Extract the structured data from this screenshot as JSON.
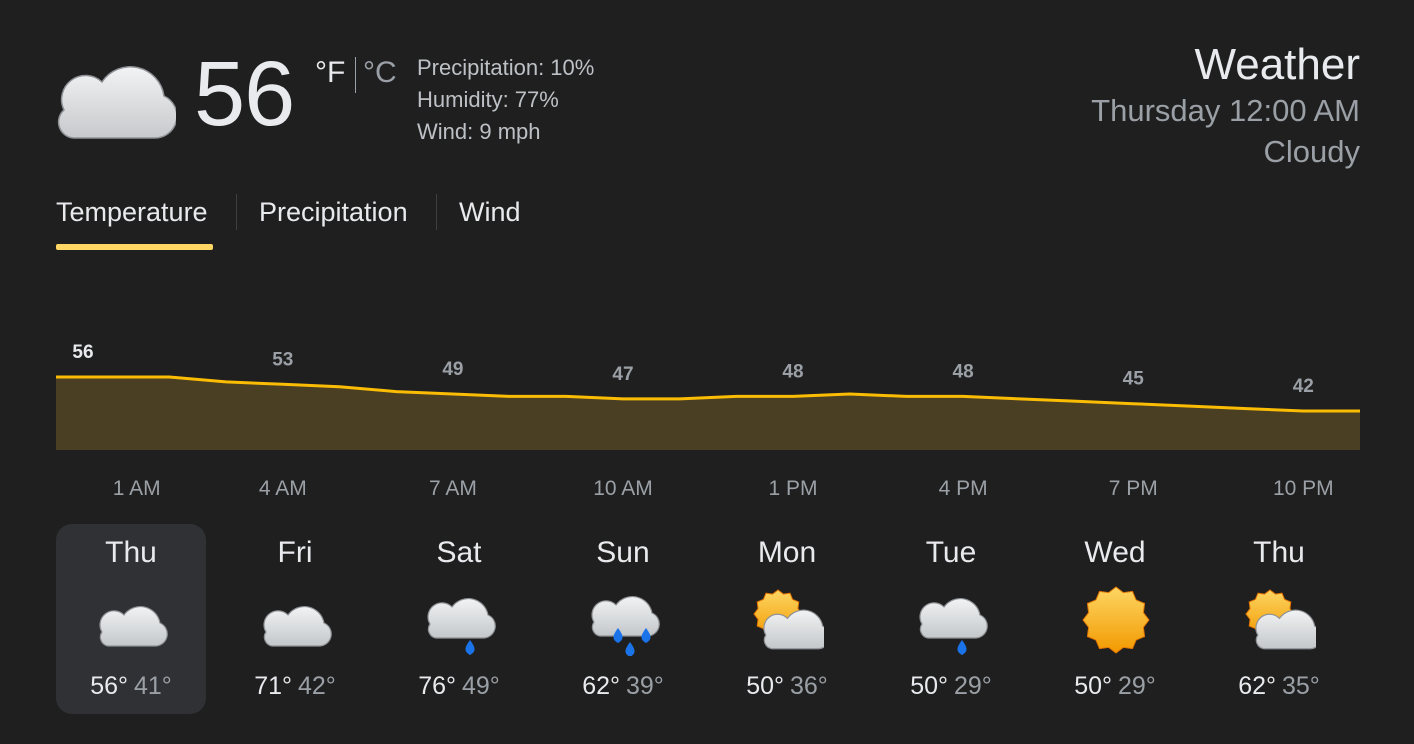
{
  "current": {
    "temperature": "56",
    "unit_f": "°F",
    "unit_c": "°C",
    "icon": "cloudy-icon",
    "precipitation": "Precipitation: 10%",
    "humidity": "Humidity: 77%",
    "wind": "Wind: 9 mph"
  },
  "header": {
    "title": "Weather",
    "time": "Thursday 12:00 AM",
    "condition": "Cloudy"
  },
  "tabs": [
    {
      "label": "Temperature",
      "active": true
    },
    {
      "label": "Precipitation",
      "active": false
    },
    {
      "label": "Wind",
      "active": false
    }
  ],
  "colors": {
    "background": "#1f1f1f",
    "accent": "#fdd663",
    "line": "#fbbc04",
    "fill": "#4a3f22",
    "selected_day": "#303134",
    "rain": "#1a73e8",
    "sun": "#f9ab00"
  },
  "chart_data": {
    "type": "area",
    "x": [
      "12 AM",
      "1 AM",
      "2 AM",
      "3 AM",
      "4 AM",
      "5 AM",
      "6 AM",
      "7 AM",
      "8 AM",
      "9 AM",
      "10 AM",
      "11 AM",
      "12 PM",
      "1 PM",
      "2 PM",
      "3 PM",
      "4 PM",
      "5 PM",
      "6 PM",
      "7 PM",
      "8 PM",
      "9 PM",
      "10 PM",
      "11 PM"
    ],
    "values": [
      56,
      56,
      56,
      54,
      53,
      52,
      50,
      49,
      48,
      48,
      47,
      47,
      48,
      48,
      49,
      48,
      48,
      47,
      46,
      45,
      44,
      43,
      42,
      42
    ],
    "labels": [
      {
        "time": "1 AM",
        "value": "56"
      },
      {
        "time": "4 AM",
        "value": "53"
      },
      {
        "time": "7 AM",
        "value": "49"
      },
      {
        "time": "10 AM",
        "value": "47"
      },
      {
        "time": "1 PM",
        "value": "48"
      },
      {
        "time": "4 PM",
        "value": "48"
      },
      {
        "time": "7 PM",
        "value": "45"
      },
      {
        "time": "10 PM",
        "value": "42"
      }
    ],
    "x_tick_labels": [
      "1 AM",
      "4 AM",
      "7 AM",
      "10 AM",
      "1 PM",
      "4 PM",
      "7 PM",
      "10 PM"
    ],
    "ylim": [
      0,
      60
    ]
  },
  "forecast": [
    {
      "day": "Thu",
      "icon": "cloudy-icon",
      "high": "56°",
      "low": "41°",
      "selected": true
    },
    {
      "day": "Fri",
      "icon": "cloudy-icon",
      "high": "71°",
      "low": "42°",
      "selected": false
    },
    {
      "day": "Sat",
      "icon": "rain-cloud-icon",
      "high": "76°",
      "low": "49°",
      "selected": false
    },
    {
      "day": "Sun",
      "icon": "heavy-rain-cloud-icon",
      "high": "62°",
      "low": "39°",
      "selected": false
    },
    {
      "day": "Mon",
      "icon": "partly-cloudy-icon",
      "high": "50°",
      "low": "36°",
      "selected": false
    },
    {
      "day": "Tue",
      "icon": "rain-cloud-icon",
      "high": "50°",
      "low": "29°",
      "selected": false
    },
    {
      "day": "Wed",
      "icon": "sunny-icon",
      "high": "50°",
      "low": "29°",
      "selected": false
    },
    {
      "day": "Thu",
      "icon": "partly-cloudy-icon",
      "high": "62°",
      "low": "35°",
      "selected": false
    }
  ]
}
